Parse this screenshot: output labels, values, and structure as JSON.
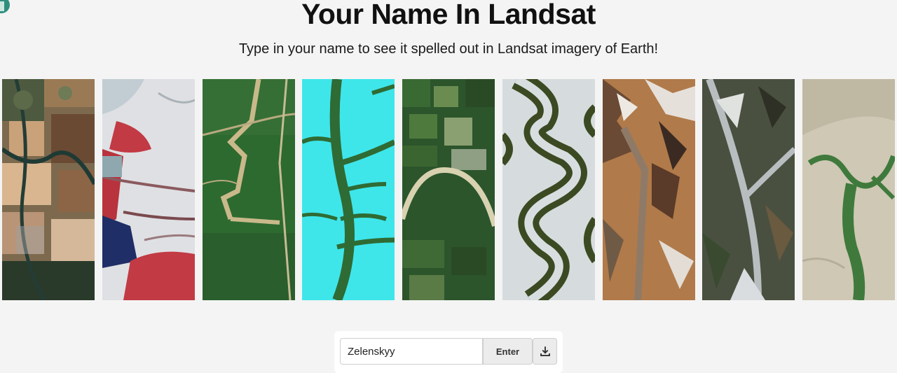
{
  "header": {
    "title": "Your Name In Landsat",
    "subtitle": "Type in your name to see it spelled out in Landsat imagery of Earth!"
  },
  "letters": [
    {
      "icon": "farmland-satellite-image",
      "colors": [
        "#8a6a4a",
        "#3c4a3a",
        "#c9a27a"
      ]
    },
    {
      "icon": "glacier-satellite-image",
      "colors": [
        "#e5e6ea",
        "#c23a44",
        "#2a3a6a"
      ]
    },
    {
      "icon": "forest-road-satellite-image",
      "colors": [
        "#2e6b30",
        "#c7b88a"
      ]
    },
    {
      "icon": "cyan-river-satellite-image",
      "colors": [
        "#3fe6ea",
        "#2f6b34"
      ]
    },
    {
      "icon": "river-bend-satellite-image",
      "colors": [
        "#2f5a2e",
        "#d8d2b0"
      ]
    },
    {
      "icon": "meander-river-satellite-image",
      "colors": [
        "#3b4a22",
        "#d8dee0"
      ]
    },
    {
      "icon": "mountain-valley-satellite-image",
      "colors": [
        "#b07a4a",
        "#e8e2dc"
      ]
    },
    {
      "icon": "braided-river-satellite-image",
      "colors": [
        "#4a5040",
        "#b5bcbe"
      ]
    },
    {
      "icon": "lake-plain-satellite-image",
      "colors": [
        "#cfc8b4",
        "#3f7a3c"
      ]
    }
  ],
  "form": {
    "input_value": "Zelenskyy",
    "enter_label": "Enter",
    "download_icon": "download-icon"
  }
}
